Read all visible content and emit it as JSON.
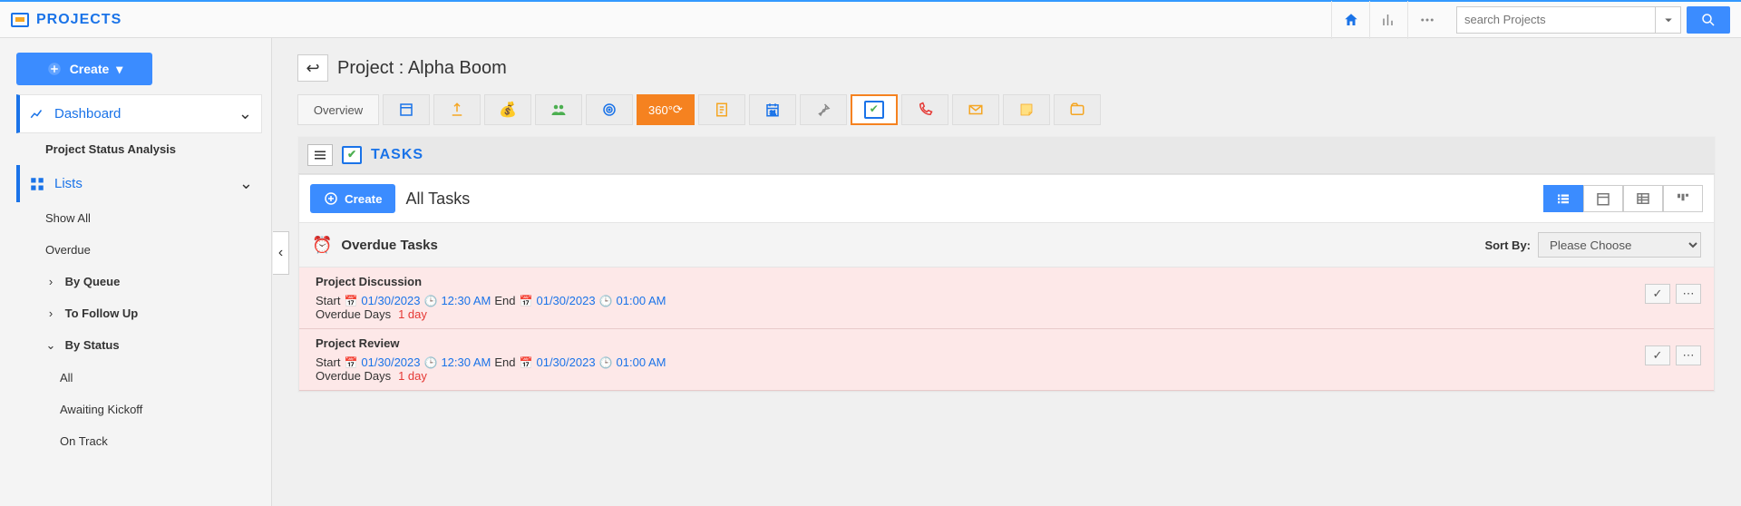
{
  "header": {
    "brand": "PROJECTS",
    "search_placeholder": "search Projects"
  },
  "sidebar": {
    "create_label": "Create",
    "dashboard_label": "Dashboard",
    "dashboard_items": [
      "Project Status Analysis"
    ],
    "lists_label": "Lists",
    "list_items": [
      "Show All",
      "Overdue"
    ],
    "by_queue_label": "By Queue",
    "follow_up_label": "To Follow Up",
    "by_status_label": "By Status",
    "status_items": [
      "All",
      "Awaiting Kickoff",
      "On Track"
    ]
  },
  "project": {
    "title_prefix": "Project :",
    "name": "Alpha Boom"
  },
  "tabs": {
    "overview_label": "Overview",
    "hot_label": "360°",
    "icons": [
      "list-icon",
      "upload-icon",
      "money-icon",
      "people-icon",
      "target-icon",
      "hot",
      "notes-icon",
      "calendar-icon",
      "pin-icon",
      "task-icon",
      "phone-icon",
      "mail-icon",
      "sticky-icon",
      "attach-icon"
    ]
  },
  "panel": {
    "title": "TASKS",
    "create_label": "Create",
    "subtitle": "All Tasks"
  },
  "section": {
    "title": "Overdue Tasks",
    "sort_label": "Sort By:",
    "sort_placeholder": "Please Choose"
  },
  "tasks": [
    {
      "name": "Project Discussion",
      "start_label": "Start",
      "start_date": "01/30/2023",
      "start_time": "12:30 AM",
      "end_label": "End",
      "end_date": "01/30/2023",
      "end_time": "01:00 AM",
      "overdue_label": "Overdue Days",
      "overdue_value": "1 day"
    },
    {
      "name": "Project Review",
      "start_label": "Start",
      "start_date": "01/30/2023",
      "start_time": "12:30 AM",
      "end_label": "End",
      "end_date": "01/30/2023",
      "end_time": "01:00 AM",
      "overdue_label": "Overdue Days",
      "overdue_value": "1 day"
    }
  ]
}
